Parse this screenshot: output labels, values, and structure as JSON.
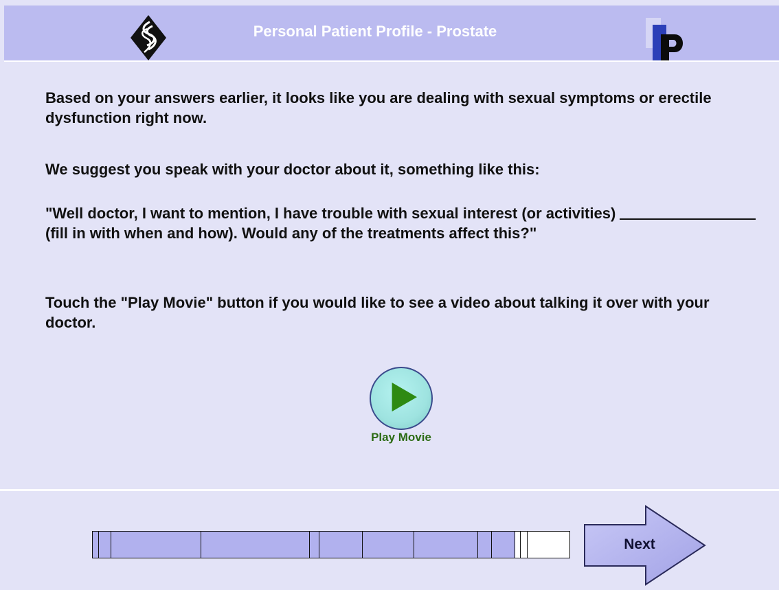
{
  "header": {
    "title": "Personal Patient Profile - Prostate",
    "left_logo_icon": "diamond-swirl-logo-icon",
    "right_logo_icon": "p-letter-logo-icon",
    "background_color": "#bbbbf0"
  },
  "content": {
    "paragraph_1": "Based on your answers earlier, it looks like you are dealing with sexual symptoms or erectile dysfunction right now.",
    "paragraph_2": "We suggest you speak with your doctor about it, something like this:",
    "paragraph_3_start": "\"Well doctor, I want to mention, I have trouble with sexual interest (or activities)",
    "paragraph_3_end": "(fill in with when and how). Would any of the treatments affect this?\"",
    "paragraph_4": "Touch the \"Play Movie\" button if you would like to see a video about talking it over with your doctor."
  },
  "play_movie": {
    "label": "Play Movie",
    "icon": "play-icon",
    "label_color": "#2c6b14"
  },
  "progress": {
    "fraction_complete": 0.885,
    "fill_color": "#b1b1ee"
  },
  "navigation": {
    "next_label": "Next",
    "icon": "right-arrow-icon"
  }
}
